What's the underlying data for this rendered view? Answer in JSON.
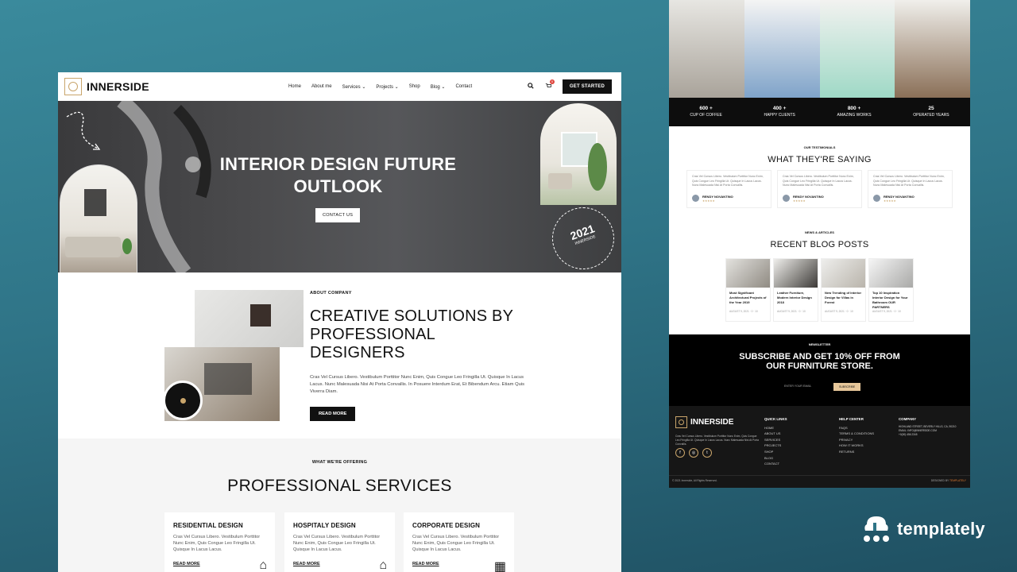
{
  "left": {
    "logo": "INNERSIDE",
    "nav": [
      "Home",
      "About me",
      "Services ⌄",
      "Projects ⌄",
      "Shop",
      "Blog ⌄",
      "Contact"
    ],
    "cart_count": "0",
    "cta": "GET STARTED",
    "hero": {
      "title": "INTERIOR DESIGN FUTURE OUTLOOK",
      "button": "CONTACT US",
      "badge_year": "2021",
      "badge_text": "INNERSIDE"
    },
    "about": {
      "tag": "ABOUT COMPANY",
      "heading": "CREATIVE SOLUTIONS BY PROFESSIONAL DESIGNERS",
      "body": "Cras Vel Cursus Libero. Vestibulum Porttitor Nunc Enim, Quis Congue Leo Fringilla Ut. Quisque In Lacus Lacus. Nunc Malesuada Nisi At Porta Convallis. In Posuere Interdum Erat, Et Bibendum Arcu. Etiam Quis Viverra Diam.",
      "button": "READ MORE"
    },
    "services": {
      "tag": "WHAT WE'RE OFFERING",
      "heading": "PROFESSIONAL SERVICES",
      "cards": [
        {
          "title": "RESIDENTIAL DESIGN",
          "body": "Cras Vel Cursus Libero. Vestibulum Porttitor Nunc Enim, Quis Congue Leo Fringilla Ut. Quisque In Lacus Lacus.",
          "link": "READ MORE",
          "icon": "house-icon"
        },
        {
          "title": "HOSPITALY DESIGN",
          "body": "Cras Vel Cursus Libero. Vestibulum Porttitor Nunc Enim, Quis Congue Leo Fringilla Ut. Quisque In Lacus Lacus.",
          "link": "READ MORE",
          "icon": "house-icon"
        },
        {
          "title": "CORPORATE DESIGN",
          "body": "Cras Vel Cursus Libero. Vestibulum Porttitor Nunc Enim, Quis Congue Leo Fringilla Ut. Quisque In Lacus Lacus.",
          "link": "READ MORE",
          "icon": "building-icon"
        }
      ]
    }
  },
  "right": {
    "stats": [
      {
        "value": "600 +",
        "label": "CUP OF COFFEE"
      },
      {
        "value": "400 +",
        "label": "HAPPY CLIENTS"
      },
      {
        "value": "800 +",
        "label": "AMAZING WORKS"
      },
      {
        "value": "25",
        "label": "OPERATED YEARS"
      }
    ],
    "testimonials": {
      "tag": "OUR TESTIMONIALS",
      "heading": "WHAT THEY'RE SAYING",
      "cards": [
        {
          "text": "Cras Vel Cursus Libero. Vestibulum Porttitor Nunc Enim, Quis Congue Leo Fringilla Ut. Quisque In Lacus Lacus. Nunc Malesuada Nisi At Porta Convallis.",
          "name": "RENDY NOVANTINO",
          "stars": "★★★★★"
        },
        {
          "text": "Cras Vel Cursus Libero. Vestibulum Porttitor Nunc Enim, Quis Congue Leo Fringilla Ut. Quisque In Lacus Lacus. Nunc Malesuada Nisi At Porta Convallis.",
          "name": "RENDY NOVANTINO",
          "stars": "★★★★★"
        },
        {
          "text": "Cras Vel Cursus Libero. Vestibulum Porttitor Nunc Enim, Quis Congue Leo Fringilla Ut. Quisque In Lacus Lacus. Nunc Malesuada Nisi At Porta Convallis.",
          "name": "RENDY NOVANTINO",
          "stars": "★★★★★"
        }
      ]
    },
    "blog": {
      "tag": "NEWS & ARTICLES",
      "heading": "RECENT BLOG POSTS",
      "posts": [
        {
          "title": "Most Significant Architectural Projects of the Year 2019",
          "date": "AUGUST 9, 2021 · 0 · 10"
        },
        {
          "title": "Leather Furniture, Modern Interior Design 2018",
          "date": "AUGUST 9, 2021 · 0 · 10"
        },
        {
          "title": "New Trending of Interior Design for Villas in Forest",
          "date": "AUGUST 9, 2021 · 0 · 10"
        },
        {
          "title": "Top 10 Inspiration Interior Design for Your Bathroom OUR PARTNERS",
          "date": "AUGUST 9, 2021 · 0 · 10"
        }
      ]
    },
    "newsletter": {
      "tag": "NEWSLETTER",
      "heading": "SUBSCRIBE AND GET 10% OFF FROM OUR FURNITURE STORE.",
      "placeholder": "ENTER YOUR EMAIL",
      "button": "SUBSCRIBE"
    },
    "footer": {
      "logo": "INNERSIDE",
      "about": "Cras Vel Cursus Libero. Vestibulum Porttitor Nunc Enim, Quis Congue Leo Fringilla Ut. Quisque In Lacus Lacus. Nunc Malesuada Nisi At Porta Convallis.",
      "quick_title": "QUICK LINKS",
      "quick": [
        "HOME",
        "ABOUT US",
        "SERVICES",
        "PROJECTS",
        "SHOP",
        "BLOG",
        "CONTACT"
      ],
      "help_title": "HELP CENTER",
      "help": [
        "FAQS",
        "TERMS & CONDITIONS",
        "PRIVACY",
        "HOW IT WORKS",
        "RETURNS"
      ],
      "company_title": "COMPANY",
      "company": [
        "HIGHLAND STREET, BEVERLY HILLS, CA, 90210",
        "EMAIL: INFO@INNERSIDE.COM",
        "+0(00) 456 2345"
      ],
      "copyright": "© 2021 Innerside, All Rights Reserved.",
      "designed": "DESIGNED BY",
      "designer": "TEMPLATELY"
    }
  },
  "brand": "templately"
}
